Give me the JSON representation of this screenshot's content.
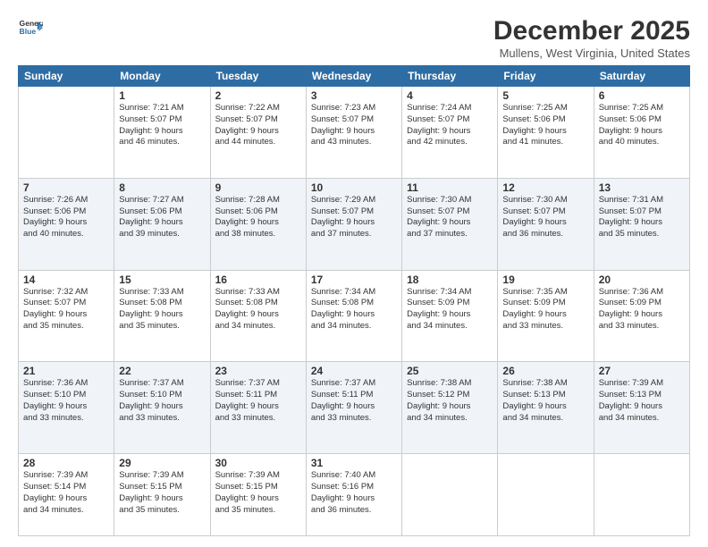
{
  "logo": {
    "line1": "General",
    "line2": "Blue"
  },
  "title": "December 2025",
  "location": "Mullens, West Virginia, United States",
  "days_of_week": [
    "Sunday",
    "Monday",
    "Tuesday",
    "Wednesday",
    "Thursday",
    "Friday",
    "Saturday"
  ],
  "weeks": [
    [
      {
        "day": "",
        "info": ""
      },
      {
        "day": "1",
        "info": "Sunrise: 7:21 AM\nSunset: 5:07 PM\nDaylight: 9 hours\nand 46 minutes."
      },
      {
        "day": "2",
        "info": "Sunrise: 7:22 AM\nSunset: 5:07 PM\nDaylight: 9 hours\nand 44 minutes."
      },
      {
        "day": "3",
        "info": "Sunrise: 7:23 AM\nSunset: 5:07 PM\nDaylight: 9 hours\nand 43 minutes."
      },
      {
        "day": "4",
        "info": "Sunrise: 7:24 AM\nSunset: 5:07 PM\nDaylight: 9 hours\nand 42 minutes."
      },
      {
        "day": "5",
        "info": "Sunrise: 7:25 AM\nSunset: 5:06 PM\nDaylight: 9 hours\nand 41 minutes."
      },
      {
        "day": "6",
        "info": "Sunrise: 7:25 AM\nSunset: 5:06 PM\nDaylight: 9 hours\nand 40 minutes."
      }
    ],
    [
      {
        "day": "7",
        "info": "Sunrise: 7:26 AM\nSunset: 5:06 PM\nDaylight: 9 hours\nand 40 minutes."
      },
      {
        "day": "8",
        "info": "Sunrise: 7:27 AM\nSunset: 5:06 PM\nDaylight: 9 hours\nand 39 minutes."
      },
      {
        "day": "9",
        "info": "Sunrise: 7:28 AM\nSunset: 5:06 PM\nDaylight: 9 hours\nand 38 minutes."
      },
      {
        "day": "10",
        "info": "Sunrise: 7:29 AM\nSunset: 5:07 PM\nDaylight: 9 hours\nand 37 minutes."
      },
      {
        "day": "11",
        "info": "Sunrise: 7:30 AM\nSunset: 5:07 PM\nDaylight: 9 hours\nand 37 minutes."
      },
      {
        "day": "12",
        "info": "Sunrise: 7:30 AM\nSunset: 5:07 PM\nDaylight: 9 hours\nand 36 minutes."
      },
      {
        "day": "13",
        "info": "Sunrise: 7:31 AM\nSunset: 5:07 PM\nDaylight: 9 hours\nand 35 minutes."
      }
    ],
    [
      {
        "day": "14",
        "info": "Sunrise: 7:32 AM\nSunset: 5:07 PM\nDaylight: 9 hours\nand 35 minutes."
      },
      {
        "day": "15",
        "info": "Sunrise: 7:33 AM\nSunset: 5:08 PM\nDaylight: 9 hours\nand 35 minutes."
      },
      {
        "day": "16",
        "info": "Sunrise: 7:33 AM\nSunset: 5:08 PM\nDaylight: 9 hours\nand 34 minutes."
      },
      {
        "day": "17",
        "info": "Sunrise: 7:34 AM\nSunset: 5:08 PM\nDaylight: 9 hours\nand 34 minutes."
      },
      {
        "day": "18",
        "info": "Sunrise: 7:34 AM\nSunset: 5:09 PM\nDaylight: 9 hours\nand 34 minutes."
      },
      {
        "day": "19",
        "info": "Sunrise: 7:35 AM\nSunset: 5:09 PM\nDaylight: 9 hours\nand 33 minutes."
      },
      {
        "day": "20",
        "info": "Sunrise: 7:36 AM\nSunset: 5:09 PM\nDaylight: 9 hours\nand 33 minutes."
      }
    ],
    [
      {
        "day": "21",
        "info": "Sunrise: 7:36 AM\nSunset: 5:10 PM\nDaylight: 9 hours\nand 33 minutes."
      },
      {
        "day": "22",
        "info": "Sunrise: 7:37 AM\nSunset: 5:10 PM\nDaylight: 9 hours\nand 33 minutes."
      },
      {
        "day": "23",
        "info": "Sunrise: 7:37 AM\nSunset: 5:11 PM\nDaylight: 9 hours\nand 33 minutes."
      },
      {
        "day": "24",
        "info": "Sunrise: 7:37 AM\nSunset: 5:11 PM\nDaylight: 9 hours\nand 33 minutes."
      },
      {
        "day": "25",
        "info": "Sunrise: 7:38 AM\nSunset: 5:12 PM\nDaylight: 9 hours\nand 34 minutes."
      },
      {
        "day": "26",
        "info": "Sunrise: 7:38 AM\nSunset: 5:13 PM\nDaylight: 9 hours\nand 34 minutes."
      },
      {
        "day": "27",
        "info": "Sunrise: 7:39 AM\nSunset: 5:13 PM\nDaylight: 9 hours\nand 34 minutes."
      }
    ],
    [
      {
        "day": "28",
        "info": "Sunrise: 7:39 AM\nSunset: 5:14 PM\nDaylight: 9 hours\nand 34 minutes."
      },
      {
        "day": "29",
        "info": "Sunrise: 7:39 AM\nSunset: 5:15 PM\nDaylight: 9 hours\nand 35 minutes."
      },
      {
        "day": "30",
        "info": "Sunrise: 7:39 AM\nSunset: 5:15 PM\nDaylight: 9 hours\nand 35 minutes."
      },
      {
        "day": "31",
        "info": "Sunrise: 7:40 AM\nSunset: 5:16 PM\nDaylight: 9 hours\nand 36 minutes."
      },
      {
        "day": "",
        "info": ""
      },
      {
        "day": "",
        "info": ""
      },
      {
        "day": "",
        "info": ""
      }
    ]
  ]
}
